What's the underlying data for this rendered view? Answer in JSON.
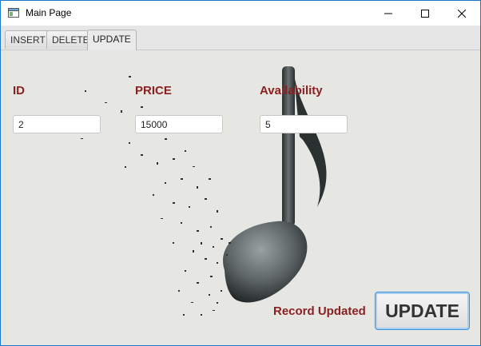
{
  "window": {
    "title": "Main Page"
  },
  "tabs": [
    {
      "label": "INSERT"
    },
    {
      "label": "DELETE"
    },
    {
      "label": "UPDATE"
    }
  ],
  "form": {
    "id": {
      "label": "ID",
      "value": "2"
    },
    "price": {
      "label": "PRICE",
      "value": "15000"
    },
    "availability": {
      "label": "Availability",
      "value": "5"
    }
  },
  "status": {
    "text": "Record Updated"
  },
  "actions": {
    "update_label": "UPDATE"
  },
  "icons": [
    "app-icon",
    "minimize-icon",
    "maximize-icon",
    "close-icon",
    "music-note-icon"
  ],
  "colors": {
    "label_color": "#8b2020",
    "background": "#e6e6e3",
    "accent_border": "#3d93d8"
  }
}
